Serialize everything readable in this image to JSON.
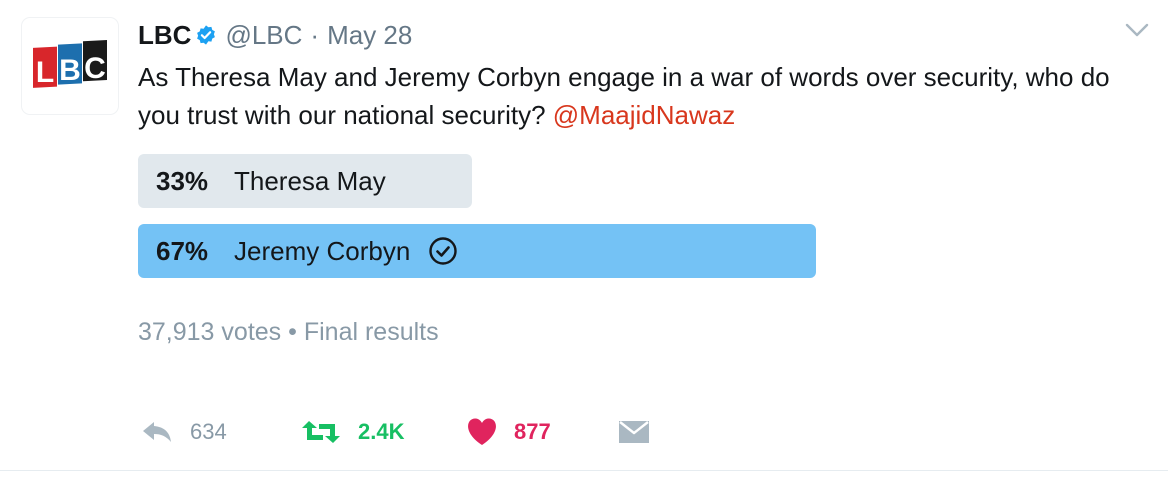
{
  "tweet": {
    "avatar_text": "LBC",
    "name": "LBC",
    "handle": "@LBC",
    "separator": "·",
    "date": "May 28",
    "text": "As Theresa May and Jeremy Corbyn engage in a war of words over security, who do you trust with our national security?",
    "mention": "@MaajidNawaz"
  },
  "poll": {
    "options": [
      {
        "percent": "33%",
        "label": "Theresa May",
        "fraction": 0.33,
        "winner": false
      },
      {
        "percent": "67%",
        "label": "Jeremy Corbyn",
        "fraction": 0.67,
        "winner": true
      }
    ],
    "votes": "37,913 votes",
    "dot": "•",
    "status": "Final results"
  },
  "actions": {
    "reply_count": "634",
    "retweet_count": "2.4K",
    "like_count": "877"
  },
  "icons": {
    "verified": "verified-badge-icon",
    "caret": "chevron-down-icon",
    "reply": "reply-icon",
    "retweet": "retweet-icon",
    "like": "heart-icon",
    "dm": "envelope-icon",
    "check": "check-circle-icon"
  },
  "colors": {
    "logo_red": "#d8262b",
    "logo_blue": "#1d6fae",
    "logo_dark": "#1a1a1a",
    "verified_blue": "#1da1f2",
    "mention": "#d8371d",
    "poll_winner": "#74c2f5",
    "poll_other": "#e1e8ed",
    "retweet_green": "#17bf63",
    "like_red": "#e0245e",
    "muted": "#8899a6"
  }
}
